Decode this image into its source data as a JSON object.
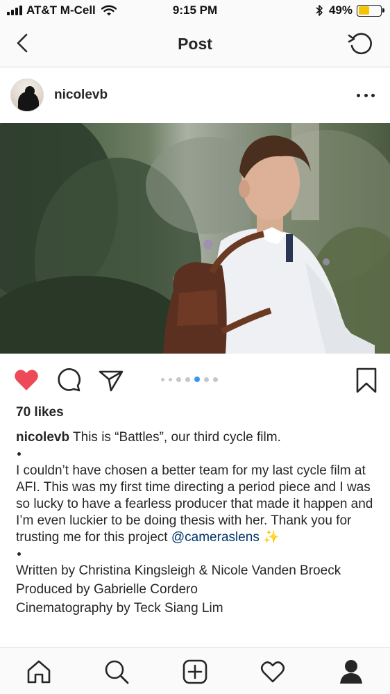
{
  "status_bar": {
    "carrier": "AT&T M-Cell",
    "time": "9:15 PM",
    "battery_text": "49%",
    "battery_level": 0.49,
    "battery_color": "#f5c400"
  },
  "nav": {
    "title": "Post",
    "back_icon": "chevron-left-icon",
    "refresh_icon": "refresh-icon"
  },
  "post": {
    "username": "nicolevb",
    "carousel": {
      "count": 7,
      "active_index": 4
    },
    "likes": "70 likes",
    "caption": {
      "username": "nicolevb",
      "line1": "This is “Battles”, our third cycle film.",
      "paragraph1": "I couldn’t have chosen a better team for my last cycle film at AFI. This was my first time directing a period piece and I was so lucky to have a fearless producer that made it happen and I’m even luckier to be doing thesis with her. Thank you for trusting me for this project ",
      "mention": "@cameraslens",
      "sparkles": "✨",
      "credit1": "Written by Christina Kingsleigh & Nicole Vanden Broeck",
      "credit2": "Produced by Gabrielle Cordero",
      "credit3": "Cinematography by Teck Siang Lim"
    }
  },
  "colors": {
    "like_red": "#ed4956",
    "active_dot": "#3897f0",
    "mention": "#003569"
  },
  "tabbar": {
    "icons": [
      "home-icon",
      "search-icon",
      "add-post-icon",
      "activity-heart-icon",
      "profile-icon"
    ]
  }
}
